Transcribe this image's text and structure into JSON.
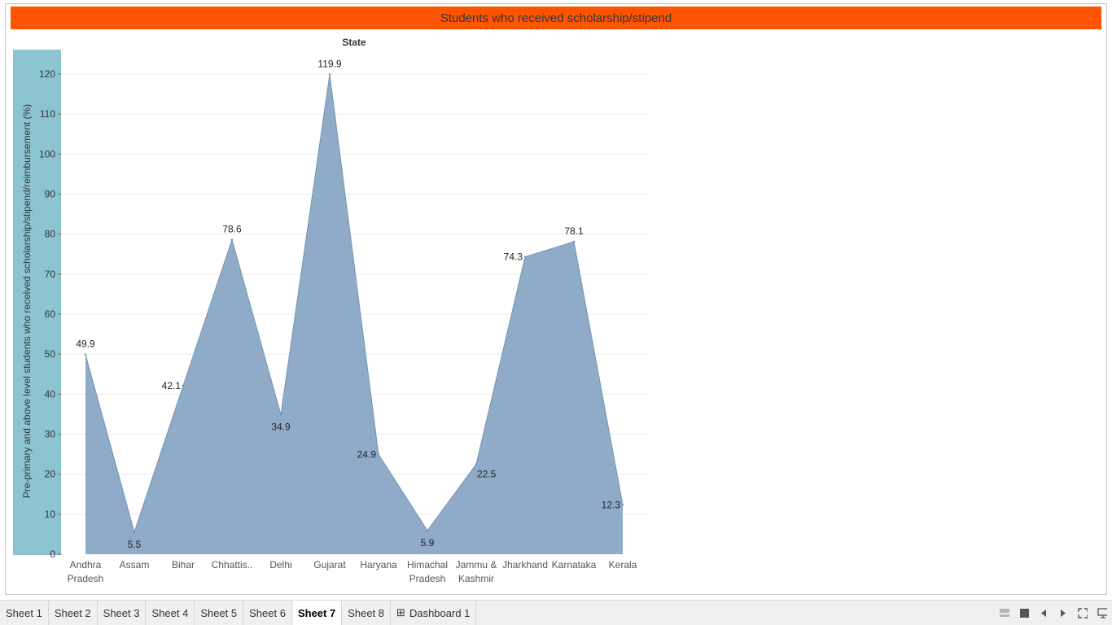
{
  "title": "Students who received scholarship/stipend",
  "chart_data": {
    "type": "area",
    "title": "Students who received scholarship/stipend",
    "xlabel": "State",
    "ylabel": "Pre-primary and above level students who received  scholarship/stipend/reimbursement (%)",
    "categories": [
      "Andhra Pradesh",
      "Assam",
      "Bihar",
      "Chhattisgarh",
      "Delhi",
      "Gujarat",
      "Haryana",
      "Himachal Pradesh",
      "Jammu & Kashmir",
      "Jharkhand",
      "Karnataka",
      "Kerala"
    ],
    "category_tick_labels": [
      [
        "Andhra",
        "Pradesh"
      ],
      [
        "Assam"
      ],
      [
        "Bihar"
      ],
      [
        "Chhattis.."
      ],
      [
        "Delhi"
      ],
      [
        "Gujarat"
      ],
      [
        "Haryana"
      ],
      [
        "Himachal",
        "Pradesh"
      ],
      [
        "Jammu &",
        "Kashmir"
      ],
      [
        "Jharkhand"
      ],
      [
        "Karnataka"
      ],
      [
        "Kerala"
      ]
    ],
    "values": [
      49.9,
      5.5,
      42.1,
      78.6,
      34.9,
      119.9,
      24.9,
      5.9,
      22.5,
      74.3,
      78.1,
      12.3
    ],
    "data_labels": [
      "49.9",
      "5.5",
      "42.1",
      "78.6",
      "34.9",
      "119.9",
      "24.9",
      "5.9",
      "22.5",
      "74.3",
      "78.1",
      "12.3"
    ],
    "ylim": [
      0,
      120
    ],
    "yticks": [
      0,
      10,
      20,
      30,
      40,
      50,
      60,
      70,
      80,
      90,
      100,
      110,
      120
    ],
    "grid": true,
    "legend": "none",
    "colors": {
      "area": "#8fabc8",
      "area_stroke": "#7393b7",
      "axis_band": "#8cc4d2",
      "title_bg": "#ff5500"
    }
  },
  "tabs": [
    {
      "label": "Sheet 1",
      "active": false
    },
    {
      "label": "Sheet 2",
      "active": false
    },
    {
      "label": "Sheet 3",
      "active": false
    },
    {
      "label": "Sheet 4",
      "active": false
    },
    {
      "label": "Sheet 5",
      "active": false
    },
    {
      "label": "Sheet 6",
      "active": false
    },
    {
      "label": "Sheet 7",
      "active": true
    },
    {
      "label": "Sheet 8",
      "active": false
    },
    {
      "label": "Dashboard 1",
      "active": false,
      "icon": "dashboard-grid-icon"
    }
  ],
  "controls": [
    "show-filmstrip-icon",
    "show-sheet-icon",
    "previous-sheet-icon",
    "next-sheet-icon",
    "fullscreen-icon",
    "presentation-icon"
  ]
}
